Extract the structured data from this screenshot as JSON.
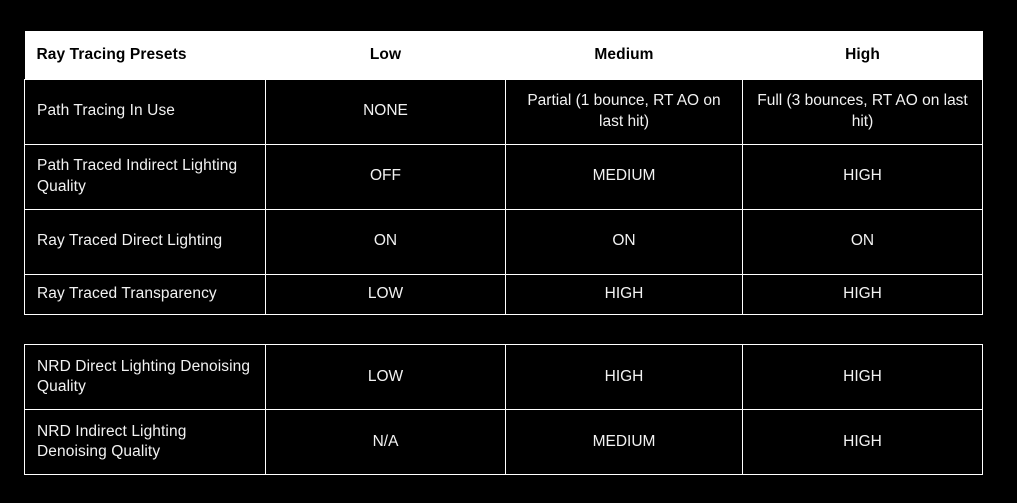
{
  "page": {
    "background_color": "#000000",
    "text_color": "#ffffff",
    "header_background_color": "#ffffff",
    "header_text_color": "#000000",
    "border_color": "#ffffff"
  },
  "tables": [
    {
      "id": "ray-tracing-presets",
      "has_header": true,
      "headers": [
        "Ray Tracing Presets",
        "Low",
        "Medium",
        "High"
      ],
      "rows": [
        {
          "label": "Path Tracing In Use",
          "low": "NONE",
          "medium": "Partial (1 bounce, RT AO on last hit)",
          "high": "Full (3 bounces, RT AO on last hit)"
        },
        {
          "label": "Path Traced Indirect Lighting Quality",
          "low": "OFF",
          "medium": "MEDIUM",
          "high": "HIGH"
        },
        {
          "label": "Ray Traced Direct Lighting",
          "low": "ON",
          "medium": "ON",
          "high": "ON"
        },
        {
          "label": "Ray Traced Transparency",
          "low": "LOW",
          "medium": "HIGH",
          "high": "HIGH"
        }
      ]
    },
    {
      "id": "nrd-denoising",
      "has_header": false,
      "headers": [],
      "rows": [
        {
          "label": "NRD Direct Lighting Denoising Quality",
          "low": "LOW",
          "medium": "HIGH",
          "high": "HIGH"
        },
        {
          "label": "NRD Indirect Lighting Denoising Quality",
          "low": "N/A",
          "medium": "MEDIUM",
          "high": "HIGH"
        }
      ]
    }
  ]
}
